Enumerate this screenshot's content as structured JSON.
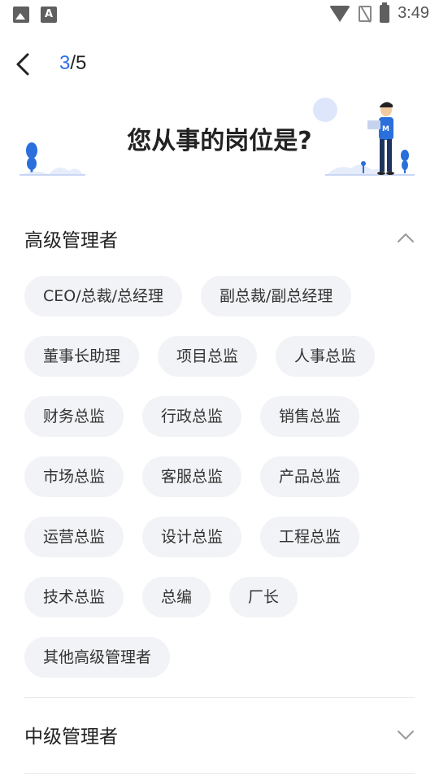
{
  "status_bar": {
    "time": "3:49",
    "left_icons": [
      "image-icon",
      "font-a-icon"
    ],
    "right_icons": [
      "wifi-icon",
      "no-sim-icon",
      "battery-charging-icon"
    ]
  },
  "nav": {
    "step_current": "3",
    "step_rest": "/5"
  },
  "banner": {
    "title": "您从事的岗位是?"
  },
  "sections": [
    {
      "title": "高级管理者",
      "expanded": true,
      "options": [
        [
          "CEO/总裁/总经理",
          "副总裁/副总经理"
        ],
        [
          "董事长助理",
          "项目总监",
          "人事总监"
        ],
        [
          "财务总监",
          "行政总监",
          "销售总监"
        ],
        [
          "市场总监",
          "客服总监",
          "产品总监"
        ],
        [
          "运营总监",
          "设计总监",
          "工程总监"
        ],
        [
          "技术总监",
          "总编",
          "厂长"
        ],
        [
          "其他高级管理者"
        ]
      ]
    },
    {
      "title": "中级管理者",
      "expanded": false
    }
  ],
  "colors": {
    "accent": "#2f6ee6",
    "chip_bg": "#f2f3f6",
    "text": "#222222"
  }
}
